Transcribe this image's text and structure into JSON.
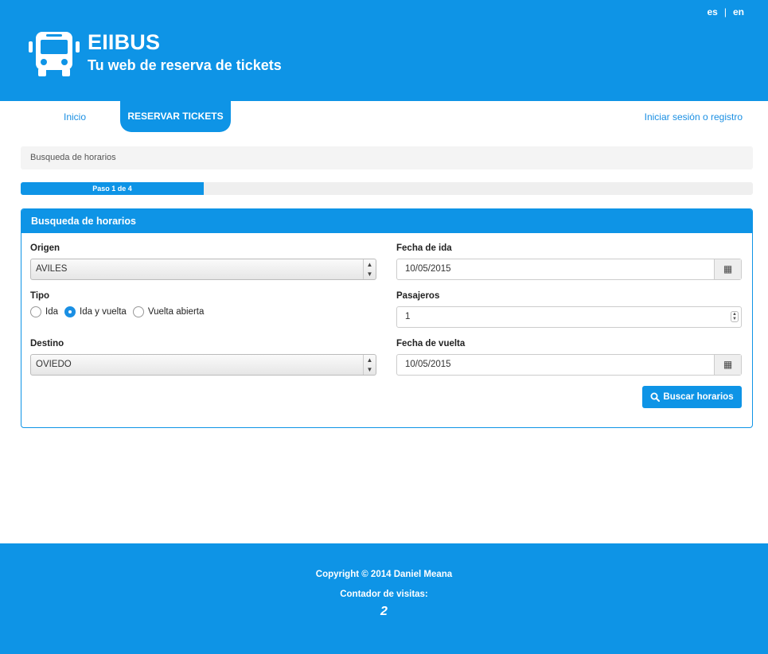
{
  "lang": {
    "es": "es",
    "sep": "|",
    "en": "en"
  },
  "brand": {
    "title": "EIIBUS",
    "subtitle": "Tu web de reserva de tickets"
  },
  "nav": {
    "inicio": "Inicio",
    "reservar": "RESERVAR TICKETS",
    "login": "Iniciar sesión o registro"
  },
  "breadcrumb": "Busqueda de horarios",
  "progress": {
    "label": "Paso 1 de 4",
    "fraction": 0.25
  },
  "panel": {
    "title": "Busqueda de horarios",
    "origen_label": "Origen",
    "origen_value": "AVILES",
    "tipo_label": "Tipo",
    "tipo_options": [
      "Ida",
      "Ida y vuelta",
      "Vuelta abierta"
    ],
    "tipo_selected": "Ida y vuelta",
    "destino_label": "Destino",
    "destino_value": "OVIEDO",
    "fecha_ida_label": "Fecha de ida",
    "fecha_ida_value": "10/05/2015",
    "pasajeros_label": "Pasajeros",
    "pasajeros_value": "1",
    "fecha_vuelta_label": "Fecha de vuelta",
    "fecha_vuelta_value": "10/05/2015",
    "search_button": "Buscar horarios"
  },
  "footer": {
    "copyright": "Copyright © 2014 Daniel Meana",
    "visits_label": "Contador de visitas:",
    "visits_count": "2"
  },
  "colors": {
    "primary": "#0e94e6",
    "link": "#1a8fe3"
  },
  "icons": {
    "logo": "bus-icon",
    "calendar": "calendar-icon",
    "search": "search-icon"
  }
}
